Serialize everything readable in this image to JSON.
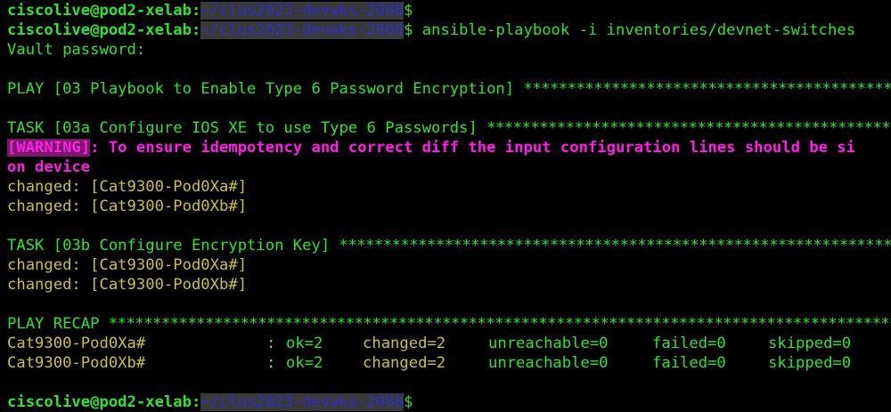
{
  "prompt": {
    "user_host": "ciscolive@pod2-xelab",
    "colon": ":",
    "path": "~/clus2023-devwks-2008",
    "symbol": "$"
  },
  "command": " ansible-playbook -i inventories/devnet-switches",
  "vault": "Vault password:",
  "play": {
    "label": "PLAY [03 Playbook to Enable Type 6 Password Encryption] ",
    "stars": "*************************************************"
  },
  "task_a": {
    "label": "TASK [03a Configure IOS XE to use Type 6 Passwords] ",
    "stars": "*****************************************************"
  },
  "warning": {
    "tag": "[WARNING]",
    "text": ": To ensure idempotency and correct diff the input configuration lines should be si",
    "cont": "on device"
  },
  "task_a_results": [
    "changed: [Cat9300-Pod0Xa#]",
    "changed: [Cat9300-Pod0Xb#]"
  ],
  "task_b": {
    "label": "TASK [03b Configure Encryption Key] ",
    "stars": "**********************************************************************"
  },
  "task_b_results": [
    "changed: [Cat9300-Pod0Xa#]",
    "changed: [Cat9300-Pod0Xb#]"
  ],
  "recap": {
    "label": "PLAY RECAP ",
    "stars": "*********************************************************************************************",
    "rows": [
      {
        "host": "Cat9300-Pod0Xa#",
        "sep": ":",
        "ok": "ok=2",
        "changed": "changed=2",
        "unreachable": "unreachable=0",
        "failed": "failed=0",
        "skipped": "skipped=0"
      },
      {
        "host": "Cat9300-Pod0Xb#",
        "sep": ":",
        "ok": "ok=2",
        "changed": "changed=2",
        "unreachable": "unreachable=0",
        "failed": "failed=0",
        "skipped": "skipped=0"
      }
    ]
  },
  "colors": {
    "green": "#2fe32f",
    "olive": "#c8c23c",
    "magenta": "#ff1ee6",
    "path_blue": "#2f2fc8"
  }
}
